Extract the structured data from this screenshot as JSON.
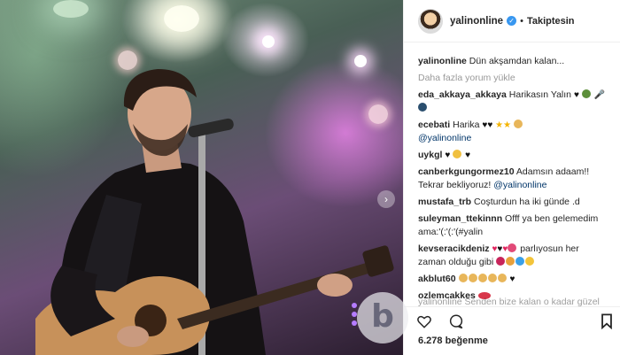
{
  "post": {
    "username": "yalinonline",
    "follow_status": "Takiptesin",
    "caption_user": "yalinonline",
    "caption_text": "Dün akşamdan kalan...",
    "load_more": "Daha fazla yorum yükle",
    "likes": "6.278 beğenme"
  },
  "comments": [
    {
      "user": "eda_akkaya_akkaya",
      "text": "Harikasın Yalın"
    },
    {
      "user": "ecebati",
      "text": "Harika",
      "mention": "@yalinonline"
    },
    {
      "user": "uykgl",
      "text": ""
    },
    {
      "user": "canberkgungormez10",
      "text": "Adamsın adaam!! Tekrar bekliyoruz!",
      "mention": "@yalinonline"
    },
    {
      "user": "mustafa_trb",
      "text": "Coşturdun ha iki günde .d"
    },
    {
      "user": "suleyman_ttekinnn",
      "text": "Offf ya ben gelemedim ama:'(:'(:'(#yalin"
    },
    {
      "user": "kevseracikdeniz",
      "text": "parlıyosun her zaman olduğu gibi"
    },
    {
      "user": "akblut60",
      "text": ""
    },
    {
      "user": "ozlemcakkes",
      "text": ""
    }
  ],
  "faded_comment": "yalinonline Senden bize kalan o kadar güzel",
  "icons": {
    "like": "heart-outline-icon",
    "comment": "comment-bubble-icon",
    "save": "bookmark-icon",
    "verified": "verified-badge-icon"
  },
  "colors": {
    "mention": "#003569",
    "verified": "#3897f0",
    "muted": "#999999"
  }
}
